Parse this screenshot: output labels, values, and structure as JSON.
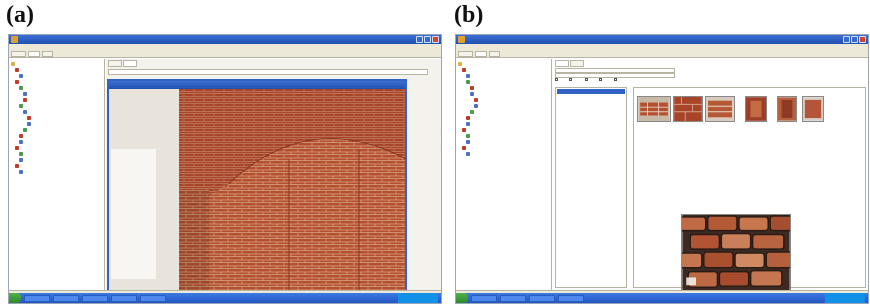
{
  "panels": [
    {
      "label": "(a)"
    },
    {
      "label": "(b)"
    }
  ],
  "colors": {
    "titlebar": "#1f4fb0",
    "taskbar": "#2456c4",
    "start": "#2f8a2c",
    "brick": "#b5502e",
    "selection": "#3163c5"
  },
  "icons": [
    "app-icon",
    "minimize-icon",
    "maximize-icon",
    "close-icon",
    "tree-node-icon",
    "start-icon"
  ]
}
